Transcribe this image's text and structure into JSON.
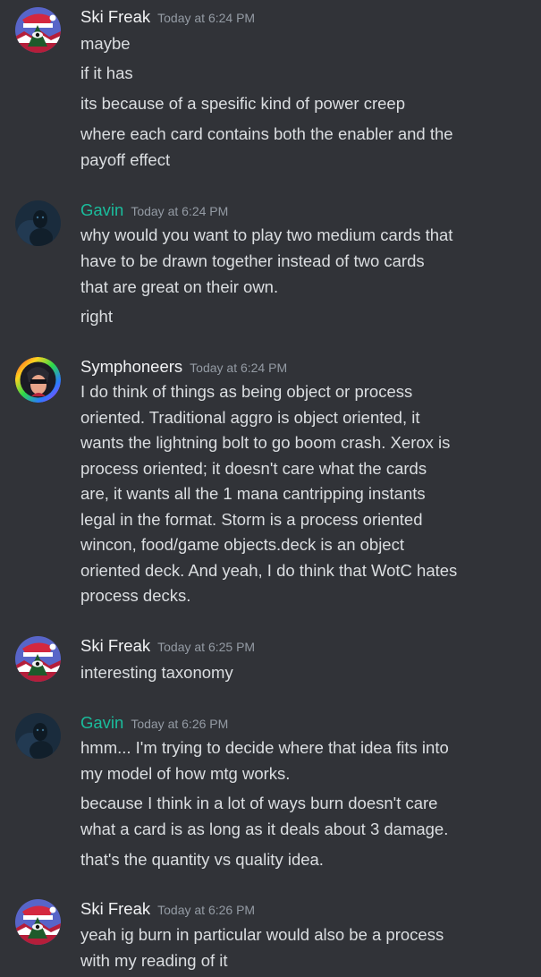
{
  "messages": [
    {
      "username": "Ski Freak",
      "timestamp": "Today at 6:24 PM",
      "avatar_icon": "ski-freak-avatar-icon",
      "lines": [
        "maybe",
        "if it has",
        "its because of a spesific kind of power creep",
        "where each card contains both the enabler and the",
        "payoff effect"
      ]
    },
    {
      "username": "Gavin",
      "timestamp": "Today at 6:24 PM",
      "avatar_icon": "gavin-avatar-icon",
      "lines": [
        "why would you want to play two medium cards that",
        "have to be drawn together instead of two cards",
        "that are great on their own.",
        "right"
      ]
    },
    {
      "username": "Symphoneers",
      "timestamp": "Today at 6:24 PM",
      "avatar_icon": "symphoneers-avatar-icon",
      "lines": [
        "I do think of things as being object or process",
        "oriented. Traditional aggro is object oriented, it",
        "wants the lightning bolt to go boom crash. Xerox is",
        "process oriented; it doesn't care what the cards",
        "are, it wants all the 1 mana cantripping instants",
        "legal in the format. Storm is a process oriented",
        "wincon, food/game objects.deck is an object",
        "oriented deck. And yeah, I do think that WotC hates",
        "process decks."
      ]
    },
    {
      "username": "Ski Freak",
      "timestamp": "Today at 6:25 PM",
      "avatar_icon": "ski-freak-avatar-icon",
      "lines": [
        "interesting taxonomy"
      ]
    },
    {
      "username": "Gavin",
      "timestamp": "Today at 6:26 PM",
      "avatar_icon": "gavin-avatar-icon",
      "lines": [
        "hmm... I'm trying to decide where that idea fits into",
        "my model of how mtg works.",
        "because I think in a lot of ways burn doesn't care",
        "what a card is as long as it deals about 3 damage.",
        "that's the quantity vs quality idea."
      ]
    },
    {
      "username": "Ski Freak",
      "timestamp": "Today at 6:26 PM",
      "avatar_icon": "ski-freak-avatar-icon",
      "lines": [
        "yeah ig burn in particular would also be a process",
        "with my reading of it"
      ]
    }
  ],
  "colors": {
    "background": "#313338",
    "text": "#dbdee1",
    "username_default": "#f2f3f5",
    "username_gavin": "#1abc9c",
    "timestamp": "#949ba4"
  }
}
